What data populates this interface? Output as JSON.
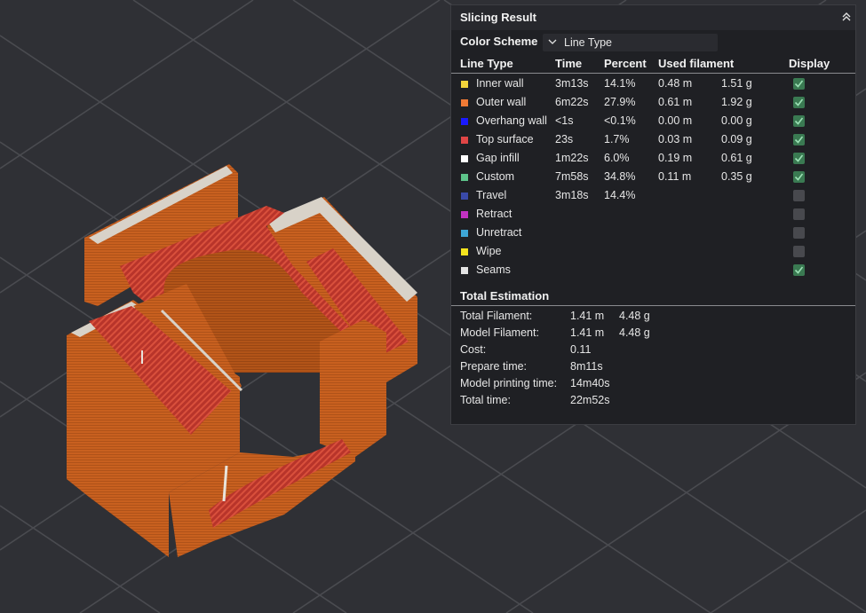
{
  "panel": {
    "title": "Slicing Result",
    "collapse_icon": "double-chevron-up-icon",
    "color_scheme_label": "Color Scheme",
    "color_scheme_value": "Line Type",
    "dropdown_icon": "chevron-down-icon",
    "columns": {
      "line_type": "Line Type",
      "time": "Time",
      "percent": "Percent",
      "used_filament": "Used filament",
      "display": "Display"
    },
    "rows": [
      {
        "name": "Inner wall",
        "color": "#f2d43c",
        "time": "3m13s",
        "percent": "14.1%",
        "length": "0.48 m",
        "weight": "1.51 g",
        "display": true
      },
      {
        "name": "Outer wall",
        "color": "#f07a35",
        "time": "6m22s",
        "percent": "27.9%",
        "length": "0.61 m",
        "weight": "1.92 g",
        "display": true
      },
      {
        "name": "Overhang wall",
        "color": "#1a1aff",
        "time": "<1s",
        "percent": "<0.1%",
        "length": "0.00 m",
        "weight": "0.00 g",
        "display": true
      },
      {
        "name": "Top surface",
        "color": "#e04646",
        "time": "23s",
        "percent": "1.7%",
        "length": "0.03 m",
        "weight": "0.09 g",
        "display": true
      },
      {
        "name": "Gap infill",
        "color": "#ffffff",
        "time": "1m22s",
        "percent": "6.0%",
        "length": "0.19 m",
        "weight": "0.61 g",
        "display": true
      },
      {
        "name": "Custom",
        "color": "#5dc48a",
        "time": "7m58s",
        "percent": "34.8%",
        "length": "0.11 m",
        "weight": "0.35 g",
        "display": true
      },
      {
        "name": "Travel",
        "color": "#3a4aa8",
        "time": "3m18s",
        "percent": "14.4%",
        "length": "",
        "weight": "",
        "display": false
      },
      {
        "name": "Retract",
        "color": "#c232c2",
        "time": "",
        "percent": "",
        "length": "",
        "weight": "",
        "display": false
      },
      {
        "name": "Unretract",
        "color": "#3ea6d6",
        "time": "",
        "percent": "",
        "length": "",
        "weight": "",
        "display": false
      },
      {
        "name": "Wipe",
        "color": "#f5e41e",
        "time": "",
        "percent": "",
        "length": "",
        "weight": "",
        "display": false
      },
      {
        "name": "Seams",
        "color": "#e4e4e4",
        "time": "",
        "percent": "",
        "length": "",
        "weight": "",
        "display": true
      }
    ],
    "total_title": "Total Estimation",
    "totals": [
      {
        "label": "Total Filament:",
        "value": "1.41 m",
        "value2": "4.48 g"
      },
      {
        "label": "Model Filament:",
        "value": "1.41 m",
        "value2": "4.48 g"
      },
      {
        "label": "Cost:",
        "value": "0.11",
        "value2": ""
      },
      {
        "label": "Prepare time:",
        "value": "8m11s",
        "value2": ""
      },
      {
        "label": "Model printing time:",
        "value": "14m40s",
        "value2": ""
      },
      {
        "label": "Total time:",
        "value": "22m52s",
        "value2": ""
      }
    ]
  },
  "colors": {
    "background": "#2f3035",
    "panel_bg": "#1f2024",
    "model_orange": "#c8601f",
    "top_surface_red": "#c03a2c",
    "check_green": "#3a7a52"
  }
}
